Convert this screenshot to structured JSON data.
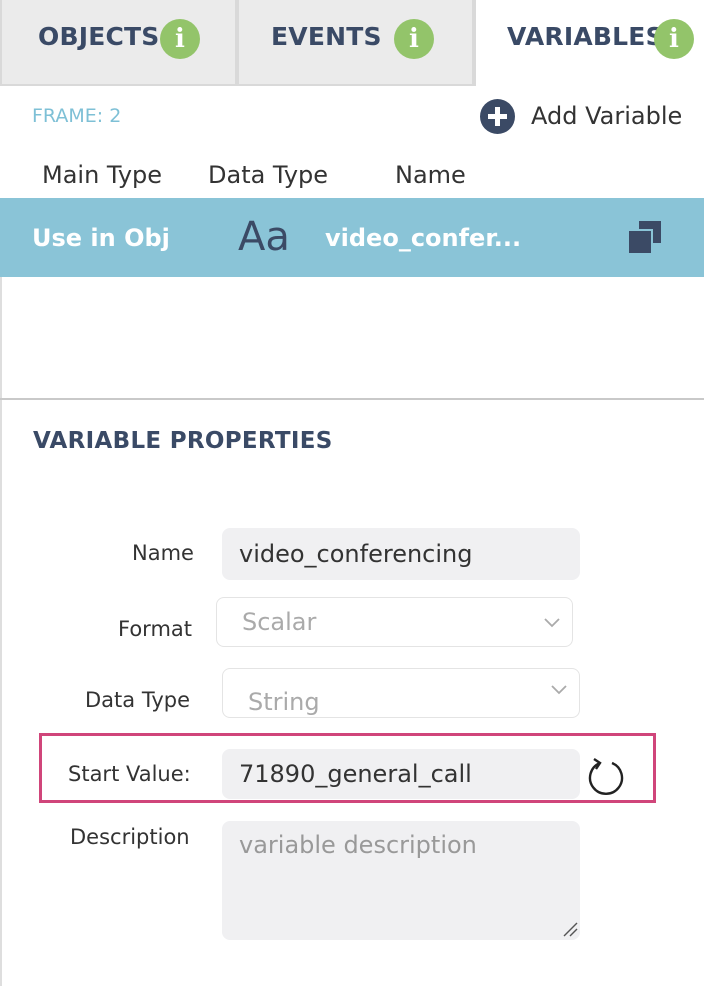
{
  "tabs": [
    {
      "label": "OBJECTS",
      "active": false
    },
    {
      "label": "EVENTS",
      "active": false
    },
    {
      "label": "VARIABLES",
      "active": true
    }
  ],
  "info_icon_glyph": "i",
  "colors": {
    "accent": "#8ac4d7",
    "navy": "#3a4a66",
    "info_green": "#93c46a",
    "highlight": "#d0457a"
  },
  "header": {
    "frame_label": "FRAME: 2",
    "add_variable_label": "Add Variable"
  },
  "columns": {
    "main_type": "Main Type",
    "data_type": "Data Type",
    "name": "Name"
  },
  "variable_row": {
    "main_type": "Use in Obj",
    "data_type_glyph": "Aa",
    "name": "video_confer..."
  },
  "properties": {
    "title": "VARIABLE PROPERTIES",
    "name_label": "Name",
    "name_value": "video_conferencing",
    "format_label": "Format",
    "format_value": "Scalar",
    "data_type_label": "Data Type",
    "data_type_value": "String",
    "start_value_label": "Start Value:",
    "start_value": "71890_general_call",
    "description_label": "Description",
    "description_placeholder": "variable description"
  }
}
